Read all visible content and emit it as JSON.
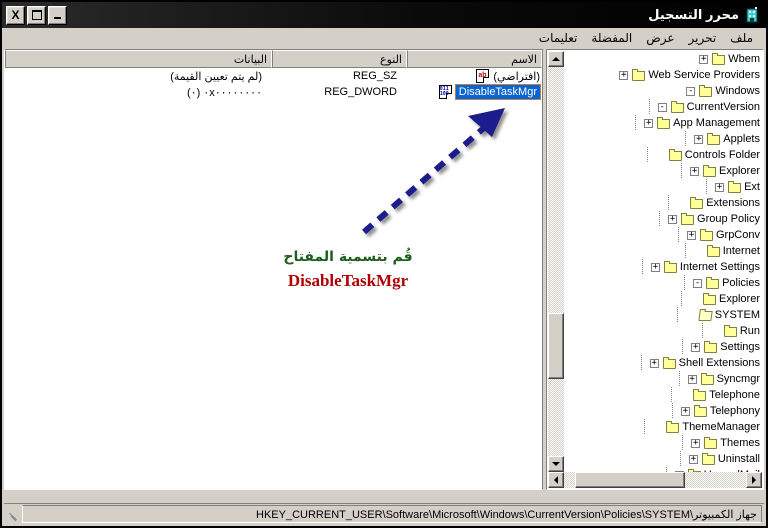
{
  "window": {
    "title": "محرر التسجيل",
    "icon": "registry-editor-icon",
    "buttons": {
      "close": "X",
      "maximize": "□",
      "minimize": "_"
    }
  },
  "menubar": {
    "items": [
      {
        "label": "ملف",
        "name": "menu-file"
      },
      {
        "label": "تحرير",
        "name": "menu-edit"
      },
      {
        "label": "عرض",
        "name": "menu-view"
      },
      {
        "label": "المفضلة",
        "name": "menu-favorites"
      },
      {
        "label": "تعليمات",
        "name": "menu-help"
      }
    ]
  },
  "list": {
    "columns": [
      {
        "label": "الاسم"
      },
      {
        "label": "النوع"
      },
      {
        "label": "البيانات"
      }
    ],
    "rows": [
      {
        "icon": "string-value-icon",
        "name": "(افتراضي)",
        "type": "REG_SZ",
        "data": "(لم يتم تعيين القيمة)",
        "selected": false
      },
      {
        "icon": "dword-value-icon",
        "name": "DisableTaskMgr",
        "type": "REG_DWORD",
        "data": "٠x٠٠٠٠٠٠٠٠ (٠)",
        "selected": true
      }
    ]
  },
  "tree": {
    "items": [
      {
        "label": "Wbem",
        "indent": 2,
        "expander": "+",
        "open": false
      },
      {
        "label": "Web Service Providers",
        "indent": 2,
        "expander": "+",
        "open": false
      },
      {
        "label": "Windows",
        "indent": 2,
        "expander": "-",
        "open": false
      },
      {
        "label": "CurrentVersion",
        "indent": 3,
        "expander": "-",
        "open": false
      },
      {
        "label": "App Management",
        "indent": 4,
        "expander": "+",
        "open": false
      },
      {
        "label": "Applets",
        "indent": 4,
        "expander": "+",
        "open": false
      },
      {
        "label": "Controls Folder",
        "indent": 4,
        "expander": "",
        "open": false
      },
      {
        "label": "Explorer",
        "indent": 4,
        "expander": "+",
        "open": false
      },
      {
        "label": "Ext",
        "indent": 4,
        "expander": "+",
        "open": false
      },
      {
        "label": "Extensions",
        "indent": 4,
        "expander": "",
        "open": false
      },
      {
        "label": "Group Policy",
        "indent": 4,
        "expander": "+",
        "open": false
      },
      {
        "label": "GrpConv",
        "indent": 4,
        "expander": "+",
        "open": false
      },
      {
        "label": "Internet",
        "indent": 4,
        "expander": "",
        "open": false
      },
      {
        "label": "Internet Settings",
        "indent": 4,
        "expander": "+",
        "open": false
      },
      {
        "label": "Policies",
        "indent": 4,
        "expander": "-",
        "open": false
      },
      {
        "label": "Explorer",
        "indent": 5,
        "expander": "",
        "open": false
      },
      {
        "label": "SYSTEM",
        "indent": 5,
        "expander": "",
        "open": true
      },
      {
        "label": "Run",
        "indent": 4,
        "expander": "",
        "open": false
      },
      {
        "label": "Settings",
        "indent": 4,
        "expander": "+",
        "open": false
      },
      {
        "label": "Shell Extensions",
        "indent": 4,
        "expander": "+",
        "open": false
      },
      {
        "label": "Syncmgr",
        "indent": 4,
        "expander": "+",
        "open": false
      },
      {
        "label": "Telephone",
        "indent": 4,
        "expander": "",
        "open": false
      },
      {
        "label": "Telephony",
        "indent": 4,
        "expander": "+",
        "open": false
      },
      {
        "label": "ThemeManager",
        "indent": 4,
        "expander": "",
        "open": false
      },
      {
        "label": "Themes",
        "indent": 4,
        "expander": "+",
        "open": false
      },
      {
        "label": "Uninstall",
        "indent": 4,
        "expander": "+",
        "open": false
      },
      {
        "label": "UnreadMail",
        "indent": 4,
        "expander": "+",
        "open": false
      }
    ]
  },
  "statusbar": {
    "path": "جهاز الكمبيوتر\\HKEY_CURRENT_USER\\Software\\Microsoft\\Windows\\CurrentVersion\\Policies\\SYSTEM"
  },
  "annotation": {
    "line1": "قُم بتسمية المفتاح",
    "line2": "DisableTaskMgr",
    "line1_color": "#1f5c1f",
    "line2_color": "#b00000",
    "arrow_color": "#1a1a8c"
  }
}
